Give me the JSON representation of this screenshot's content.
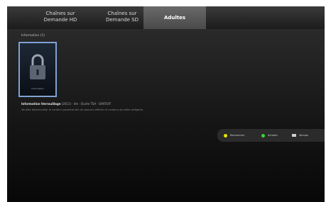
{
  "tabs": [
    {
      "line1": "Chaînes sur",
      "line2": "Demande HD"
    },
    {
      "line1": "Chaînes sur",
      "line2": "Demande SD"
    },
    {
      "label": "Adultes"
    }
  ],
  "section_title": "Information (1)",
  "tile": {
    "caption": "Information"
  },
  "program": {
    "title": "Information Verrouillage",
    "meta": " (2011) · 4m · Durée TSA · GRATUIT"
  },
  "description": "Veuillez déverrouiller le contenu parental afin de pouvoir afficher le contenu de cette catégorie.",
  "legend": [
    {
      "label": "Rechercher",
      "color": "#e6e600"
    },
    {
      "label": "Acheter",
      "color": "#39d63a"
    },
    {
      "label": "Version"
    }
  ],
  "colors": {
    "selected_border": "#7fa2d4"
  }
}
